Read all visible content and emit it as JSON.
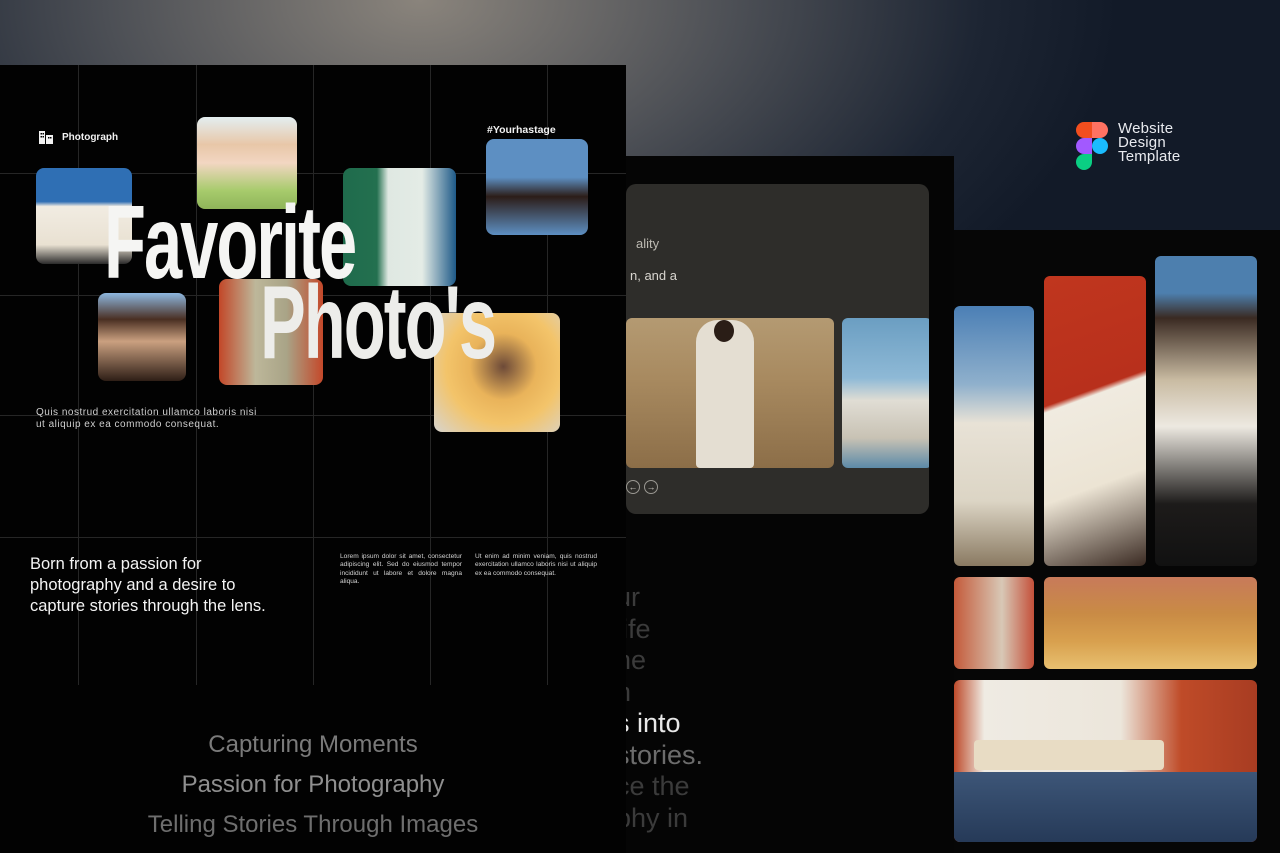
{
  "badge": {
    "line1": "Website",
    "line2": "Design",
    "line3": "Template",
    "colors": [
      "#f24e1e",
      "#ff7262",
      "#a259ff",
      "#1abcfe",
      "#0acf83"
    ]
  },
  "left_page": {
    "brand": "Photograph",
    "hashtag": "#Yourhastage",
    "headline_1": "Favorite",
    "headline_2": "Photo's",
    "intro": "Quis nostrud exercitation ullamco laboris nisi ut aliquip ex ea commodo consequat.",
    "about": "Born from a passion for photography and a desire to capture stories through the lens.",
    "col_1": "Lorem ipsum dolor sit amet, consectetur adipiscing elit. Sed do eiusmod tempor incididunt ut labore et dolore magna aliqua.",
    "col_2": "Ut enim ad minim veniam, quis nostrud exercitation ullamco laboris nisi ut aliquip ex ea commodo consequat.",
    "taglines": [
      "Capturing Moments",
      "Passion for Photography",
      "Telling Stories Through Images"
    ]
  },
  "middle_page": {
    "card_text_1": "ality",
    "card_text_2": "n, and a",
    "big_text": [
      "ur",
      "life",
      "he",
      "n",
      "s into",
      "stories.",
      "ce the",
      "",
      "phy in"
    ]
  }
}
